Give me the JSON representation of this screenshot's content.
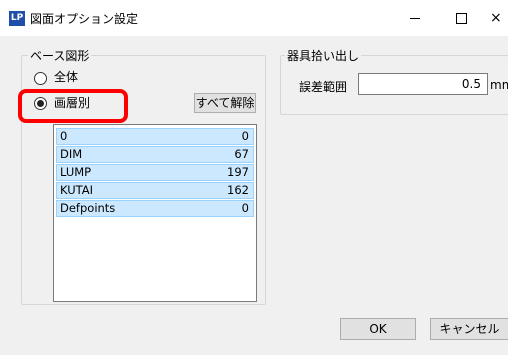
{
  "window": {
    "app_icon_text": "LP",
    "title": "図面オプション設定",
    "minimize_symbol": "",
    "close_symbol": "×"
  },
  "base_group": {
    "label": "ベース図形",
    "radio_all_label": "全体",
    "radio_layer_label": "画層別",
    "selected": "画層別",
    "clear_all_label": "すべて解除",
    "layers": [
      {
        "name": "0",
        "count": "0"
      },
      {
        "name": "DIM",
        "count": "67"
      },
      {
        "name": "LUMP",
        "count": "197"
      },
      {
        "name": "KUTAI",
        "count": "162"
      },
      {
        "name": "Defpoints",
        "count": "0"
      }
    ]
  },
  "pick_group": {
    "label": "器具拾い出し",
    "tolerance_label": "誤差範囲",
    "tolerance_value": "0.5",
    "unit": "mm"
  },
  "footer": {
    "ok_label": "OK",
    "cancel_label": "キャンセル"
  },
  "highlight_color": "#ff0000"
}
